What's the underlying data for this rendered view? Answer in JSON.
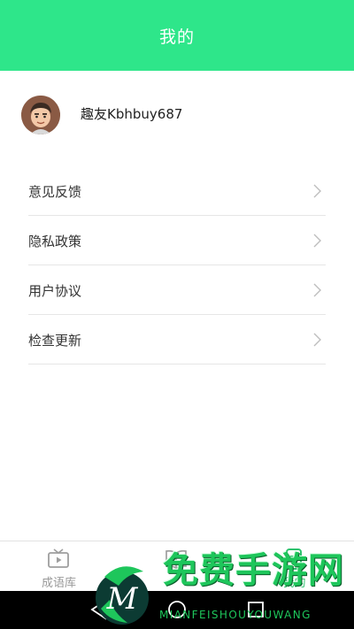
{
  "header": {
    "title": "我的"
  },
  "profile": {
    "username": "趣友Kbhbuy687"
  },
  "menu": {
    "items": [
      {
        "label": "意见反馈"
      },
      {
        "label": "隐私政策"
      },
      {
        "label": "用户协议"
      },
      {
        "label": "检查更新"
      }
    ]
  },
  "tabbar": {
    "tabs": [
      {
        "label": "成语库",
        "icon": "tv-icon"
      },
      {
        "label": "",
        "icon": "book-icon"
      },
      {
        "label": "我的",
        "icon": "document-icon"
      }
    ],
    "active_color": "#2ec26e"
  },
  "watermark": {
    "chinese": "免费手游网",
    "english": "MIANFEISHOUYOUWANG",
    "letter": "M"
  },
  "colors": {
    "accent": "#2ee68a",
    "watermark": "#1ec65b"
  }
}
